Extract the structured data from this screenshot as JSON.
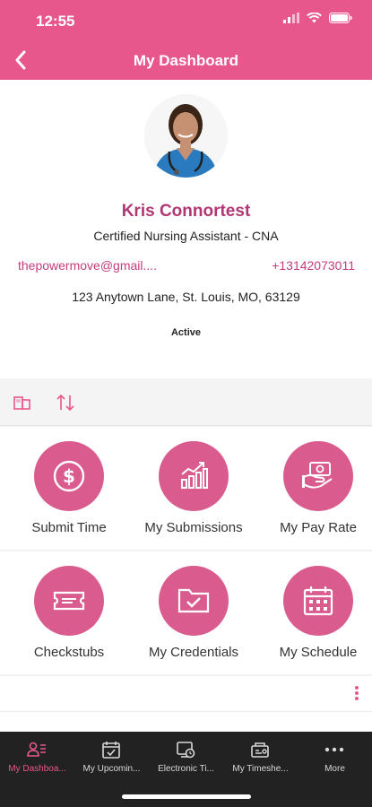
{
  "status_bar": {
    "time": "12:55"
  },
  "header": {
    "title": "My Dashboard"
  },
  "profile": {
    "name": "Kris Connortest",
    "role": "Certified Nursing Assistant - CNA",
    "email": "thepowermove@gmail....",
    "phone": "+13142073011",
    "address": "123 Anytown Lane, St. Louis, MO, 63129",
    "status": "Active"
  },
  "tiles": [
    {
      "label": "Submit Time",
      "icon": "dollar-circle-icon"
    },
    {
      "label": "My Submissions",
      "icon": "bar-chart-icon"
    },
    {
      "label": "My Pay Rate",
      "icon": "pay-rate-icon"
    },
    {
      "label": "Checkstubs",
      "icon": "ticket-icon"
    },
    {
      "label": "My Credentials",
      "icon": "folder-check-icon"
    },
    {
      "label": "My Schedule",
      "icon": "calendar-icon"
    }
  ],
  "tabbar": {
    "items": [
      {
        "label": "My Dashboa...",
        "icon": "dashboard-icon",
        "active": true
      },
      {
        "label": "My Upcomin...",
        "icon": "calendar-check-icon",
        "active": false
      },
      {
        "label": "Electronic Ti...",
        "icon": "device-clock-icon",
        "active": false
      },
      {
        "label": "My Timeshe...",
        "icon": "timesheet-icon",
        "active": false
      },
      {
        "label": "More",
        "icon": "more-horizontal-icon",
        "active": false
      }
    ]
  },
  "colors": {
    "brand": "#e8578c",
    "name": "#b23673",
    "tile": "#da5c8f",
    "tabbar": "#222222"
  }
}
